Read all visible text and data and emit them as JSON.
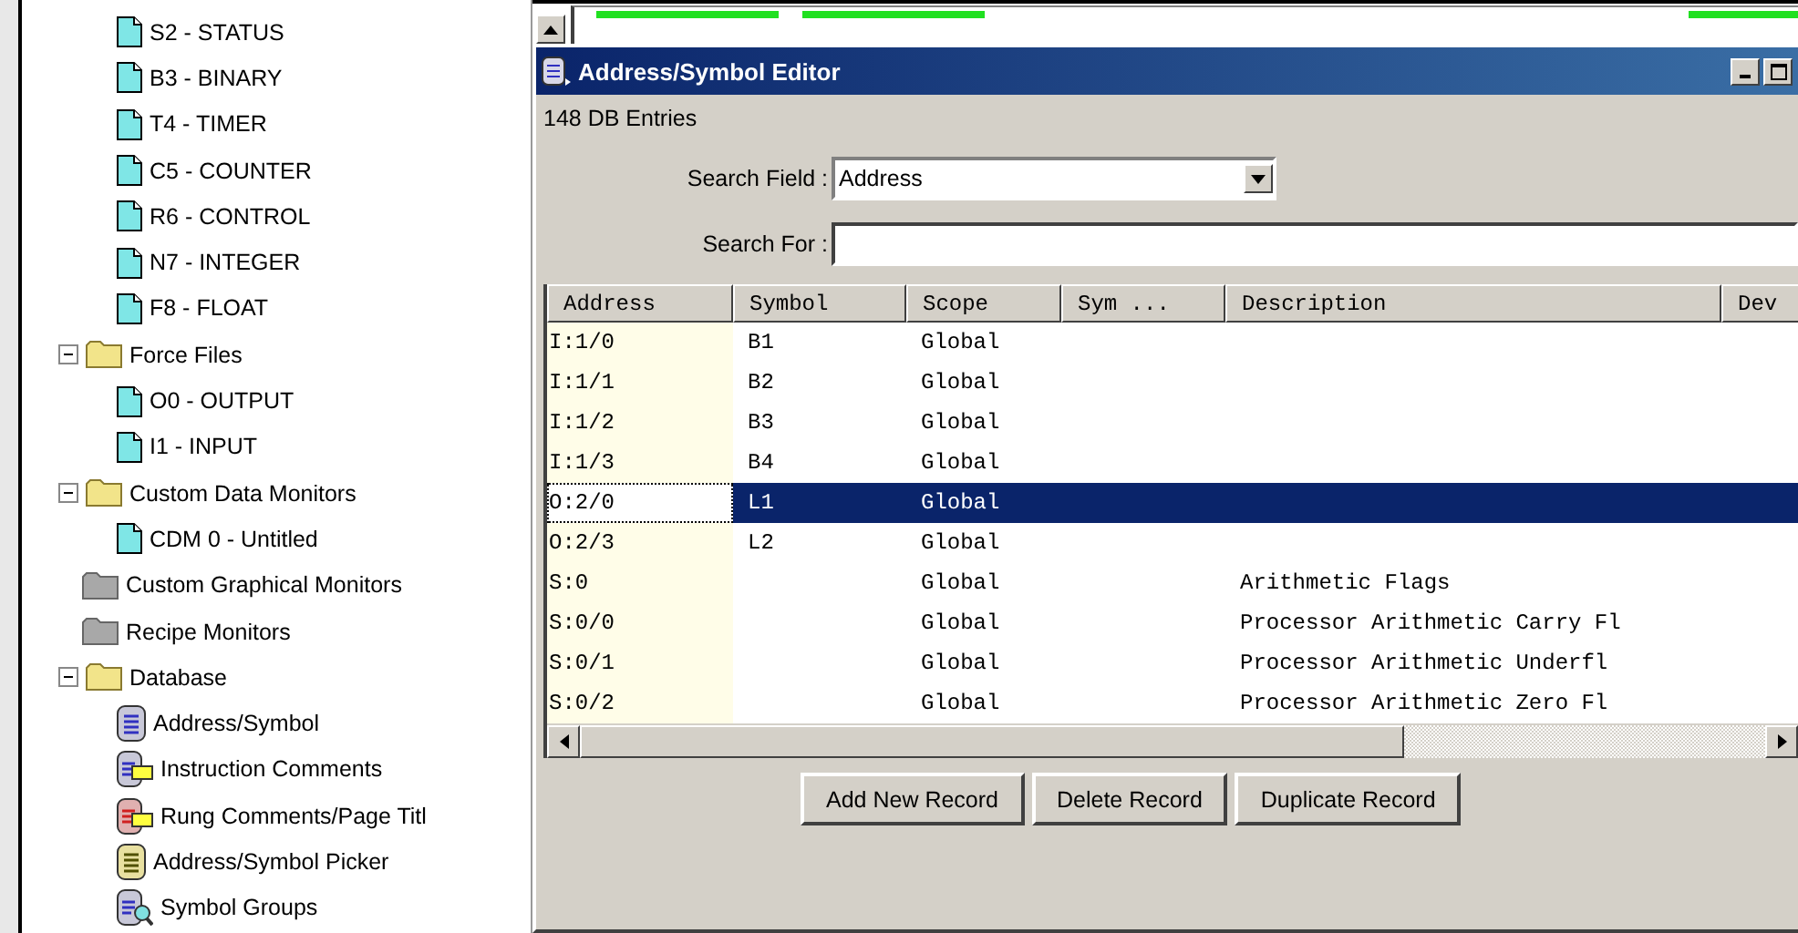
{
  "tree": {
    "orphan_items": [
      {
        "label": "S2 - STATUS",
        "kind": "file"
      },
      {
        "label": "B3 - BINARY",
        "kind": "file"
      },
      {
        "label": "T4 - TIMER",
        "kind": "file"
      },
      {
        "label": "C5 - COUNTER",
        "kind": "file"
      },
      {
        "label": "R6 - CONTROL",
        "kind": "file"
      },
      {
        "label": "N7 - INTEGER",
        "kind": "file"
      },
      {
        "label": "F8 - FLOAT",
        "kind": "file"
      }
    ],
    "items": [
      {
        "label": "Force Files",
        "kind": "folder",
        "expanded": true,
        "children": [
          {
            "label": "O0 - OUTPUT",
            "kind": "file"
          },
          {
            "label": "I1 - INPUT",
            "kind": "file"
          }
        ]
      },
      {
        "label": "Custom Data Monitors",
        "kind": "folder",
        "expanded": true,
        "children": [
          {
            "label": "CDM 0 - Untitled",
            "kind": "file"
          }
        ]
      },
      {
        "label": "Custom Graphical Monitors",
        "kind": "empty-folder"
      },
      {
        "label": "Recipe Monitors",
        "kind": "empty-folder"
      },
      {
        "label": "Database",
        "kind": "folder",
        "expanded": true,
        "children": [
          {
            "label": "Address/Symbol",
            "kind": "db-list"
          },
          {
            "label": "Instruction Comments",
            "kind": "db-comment"
          },
          {
            "label": "Rung Comments/Page Titl",
            "kind": "db-rung"
          },
          {
            "label": "Address/Symbol Picker",
            "kind": "db-picker"
          },
          {
            "label": "Symbol Groups",
            "kind": "db-group"
          }
        ]
      }
    ]
  },
  "window": {
    "title": "Address/Symbol Editor",
    "entries": "148  DB Entries",
    "search_field": {
      "label": "Search Field :",
      "value": "Address"
    },
    "search_for": {
      "label": "Search For :"
    },
    "table": {
      "columns": [
        "Address",
        "Symbol",
        "Scope",
        "Sym ...",
        "Description",
        "Dev"
      ],
      "rows": [
        {
          "cells": [
            "I:1/0",
            "B1",
            "Global",
            "",
            ""
          ],
          "selected": false
        },
        {
          "cells": [
            "I:1/1",
            "B2",
            "Global",
            "",
            ""
          ],
          "selected": false
        },
        {
          "cells": [
            "I:1/2",
            "B3",
            "Global",
            "",
            ""
          ],
          "selected": false
        },
        {
          "cells": [
            "I:1/3",
            "B4",
            "Global",
            "",
            ""
          ],
          "selected": false
        },
        {
          "cells": [
            "O:2/0",
            "L1",
            "Global",
            "",
            ""
          ],
          "selected": true
        },
        {
          "cells": [
            "O:2/3",
            "L2",
            "Global",
            "",
            ""
          ],
          "selected": false
        },
        {
          "cells": [
            "S:0",
            "",
            "Global",
            "",
            "Arithmetic Flags"
          ],
          "selected": false
        },
        {
          "cells": [
            "S:0/0",
            "",
            "Global",
            "",
            "Processor Arithmetic Carry Fl"
          ],
          "selected": false
        },
        {
          "cells": [
            "S:0/1",
            "",
            "Global",
            "",
            "Processor Arithmetic Underfl"
          ],
          "selected": false
        },
        {
          "cells": [
            "S:0/2",
            "",
            "Global",
            "",
            "Processor Arithmetic Zero Fl"
          ],
          "selected": false
        }
      ]
    },
    "buttons": [
      "Add New Record",
      "Delete Record",
      "Duplicate Record"
    ]
  }
}
